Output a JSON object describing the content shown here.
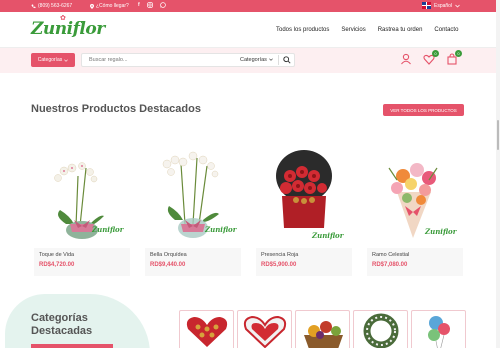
{
  "topbar": {
    "phone": "(809) 563-6267",
    "howto": "¿Cómo llegar?",
    "language": "Español"
  },
  "header": {
    "logo_text": "Zuniflor",
    "nav": [
      "Todos los productos",
      "Servicios",
      "Rastrea tu orden",
      "Contacto"
    ]
  },
  "search": {
    "category_button": "Categorías",
    "placeholder": "Buscar regalo...",
    "category_select": "Categorías"
  },
  "badges": {
    "wishlist": "0",
    "cart": "0"
  },
  "featured": {
    "title": "Nuestros Productos Destacados",
    "view_all": "VER TODOS LOS PRODUCTOS",
    "products": [
      {
        "name": "Toque de Vida",
        "price": "RD$4,720.00"
      },
      {
        "name": "Bella Orquídea",
        "price": "RD$9,440.00"
      },
      {
        "name": "Presencia Roja",
        "price": "RD$5,900.00"
      },
      {
        "name": "Ramo Celestial",
        "price": "RD$7,080.00"
      }
    ],
    "brand_tag": "Zuniflor"
  },
  "categories": {
    "title_line1": "Categorías",
    "title_line2": "Destacadas"
  },
  "colors": {
    "accent": "#e5536a",
    "brand_green": "#3a9b3a"
  }
}
